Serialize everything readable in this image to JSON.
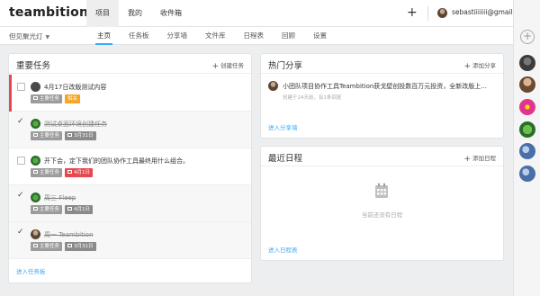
{
  "app": {
    "logo": "teambition"
  },
  "top_nav": {
    "items": [
      {
        "label": "项目",
        "active": true
      },
      {
        "label": "我的",
        "active": false
      },
      {
        "label": "收件箱",
        "active": false
      }
    ],
    "add_label": "+",
    "user_email": "sebastiiiiiii@gmail.com"
  },
  "sub_nav": {
    "project": "但见聚光灯",
    "tabs": [
      {
        "label": "主页",
        "active": true
      },
      {
        "label": "任务板",
        "active": false
      },
      {
        "label": "分享墙",
        "active": false
      },
      {
        "label": "文件库",
        "active": false
      },
      {
        "label": "日程表",
        "active": false
      },
      {
        "label": "回顾",
        "active": false
      },
      {
        "label": "设置",
        "active": false
      }
    ]
  },
  "tasks_card": {
    "title": "重要任务",
    "action": "创建任务",
    "footer": "进入任务板",
    "tasks": [
      {
        "text": "4月17日改版测试内容",
        "done": false,
        "flag": true,
        "tag": "主要任务",
        "extra_tag": "相关",
        "extra_color": "orange"
      },
      {
        "text": "测试桌面环境创建任务",
        "done": true,
        "flag": false,
        "tag": "主要任务",
        "extra_tag": "3月31日",
        "extra_color": "due"
      },
      {
        "text": "开下会，定下我们的团队协作工具最终用什么组合。",
        "done": false,
        "flag": false,
        "tag": "主要任务",
        "extra_tag": "4月1日",
        "extra_color": "red"
      },
      {
        "text": "周三 Fleep",
        "done": true,
        "flag": false,
        "tag": "主要任务",
        "extra_tag": "4月1日",
        "extra_color": "due"
      },
      {
        "text": "周一 Teambition",
        "done": true,
        "flag": false,
        "tag": "主要任务",
        "extra_tag": "3月31日",
        "extra_color": "due"
      }
    ]
  },
  "share_card": {
    "title": "热门分享",
    "action": "添加分享",
    "item_title": "小团队项目协作工具Teambition获戈壁创投数百万元投资，全新改版上...",
    "item_meta": "创建于24天前，有1条回复",
    "footer": "进入分享墙"
  },
  "calendar_card": {
    "title": "最近日程",
    "action": "添加日程",
    "empty_text": "当前还没有日程",
    "footer": "进入日程表"
  },
  "colors": {
    "accent": "#3da8f5",
    "flag": "#e5484d",
    "orange_tag": "#f5a623",
    "grey_tag": "#9c9c9c"
  }
}
